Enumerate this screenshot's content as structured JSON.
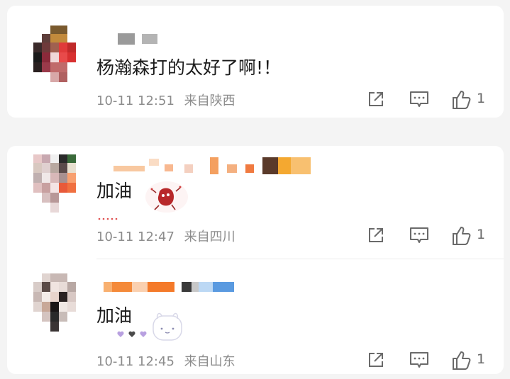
{
  "comments": [
    {
      "text": "杨瀚森打的太好了啊!！",
      "time": "10-11 12:51",
      "location": "来自陕西",
      "likes": "1",
      "icons": [
        "share-icon",
        "comment-icon",
        "like-icon"
      ]
    },
    {
      "text": "加油",
      "sticker": "red-bean-sticker",
      "time": "10-11 12:47",
      "location": "来自四川",
      "likes": "1",
      "icons": [
        "share-icon",
        "comment-icon",
        "like-icon"
      ]
    },
    {
      "text": "加油",
      "sticker": "bunny-hearts-sticker",
      "time": "10-11 12:45",
      "location": "来自山东",
      "likes": "1",
      "icons": [
        "share-icon",
        "comment-icon",
        "like-icon"
      ]
    }
  ],
  "colors": {
    "text": "#1a1a1a",
    "meta": "#8c8c8c",
    "icon": "#6a6a6a",
    "background": "#f4f4f4",
    "card": "#ffffff"
  }
}
